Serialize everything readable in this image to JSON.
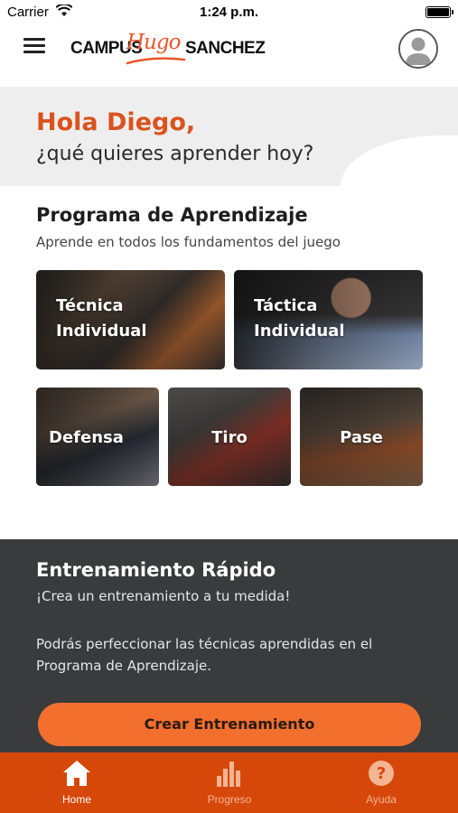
{
  "status_bar": {
    "carrier": "Carrier",
    "time": "1:24 p.m."
  },
  "header": {
    "logo_left": "CAMPUS",
    "logo_script": "Hugo",
    "logo_right": "SANCHEZ",
    "menu_icon": "hamburger-menu-icon",
    "avatar_icon": "user-avatar-icon"
  },
  "greeting": {
    "hello": "Hola Diego,",
    "question": "¿qué quieres aprender hoy?"
  },
  "program": {
    "title": "Programa de Aprendizaje",
    "subtitle": "Aprende en todos los fundamentos del juego",
    "cards": [
      {
        "line1": "Técnica",
        "line2": "Individual"
      },
      {
        "line1": "Táctica",
        "line2": "Individual"
      },
      {
        "label": "Defensa"
      },
      {
        "label": "Tiro"
      },
      {
        "label": "Pase"
      }
    ]
  },
  "quick_training": {
    "title": "Entrenamiento Rápido",
    "subtitle": "¡Crea un entrenamiento a tu medida!",
    "description": "Podrás perfeccionar las técnicas aprendidas en el Programa de Aprendizaje.",
    "button": "Crear Entrenamiento"
  },
  "tab_bar": {
    "tabs": [
      {
        "label": "Home",
        "icon": "home-icon",
        "active": true
      },
      {
        "label": "Progreso",
        "icon": "bar-chart-icon",
        "active": false
      },
      {
        "label": "Ayuda",
        "icon": "question-icon",
        "active": false
      }
    ]
  },
  "colors": {
    "accent": "#d9531e",
    "button": "#f26f2e",
    "tabbar": "#d6470a",
    "dark_panel": "#3a3b3d"
  }
}
